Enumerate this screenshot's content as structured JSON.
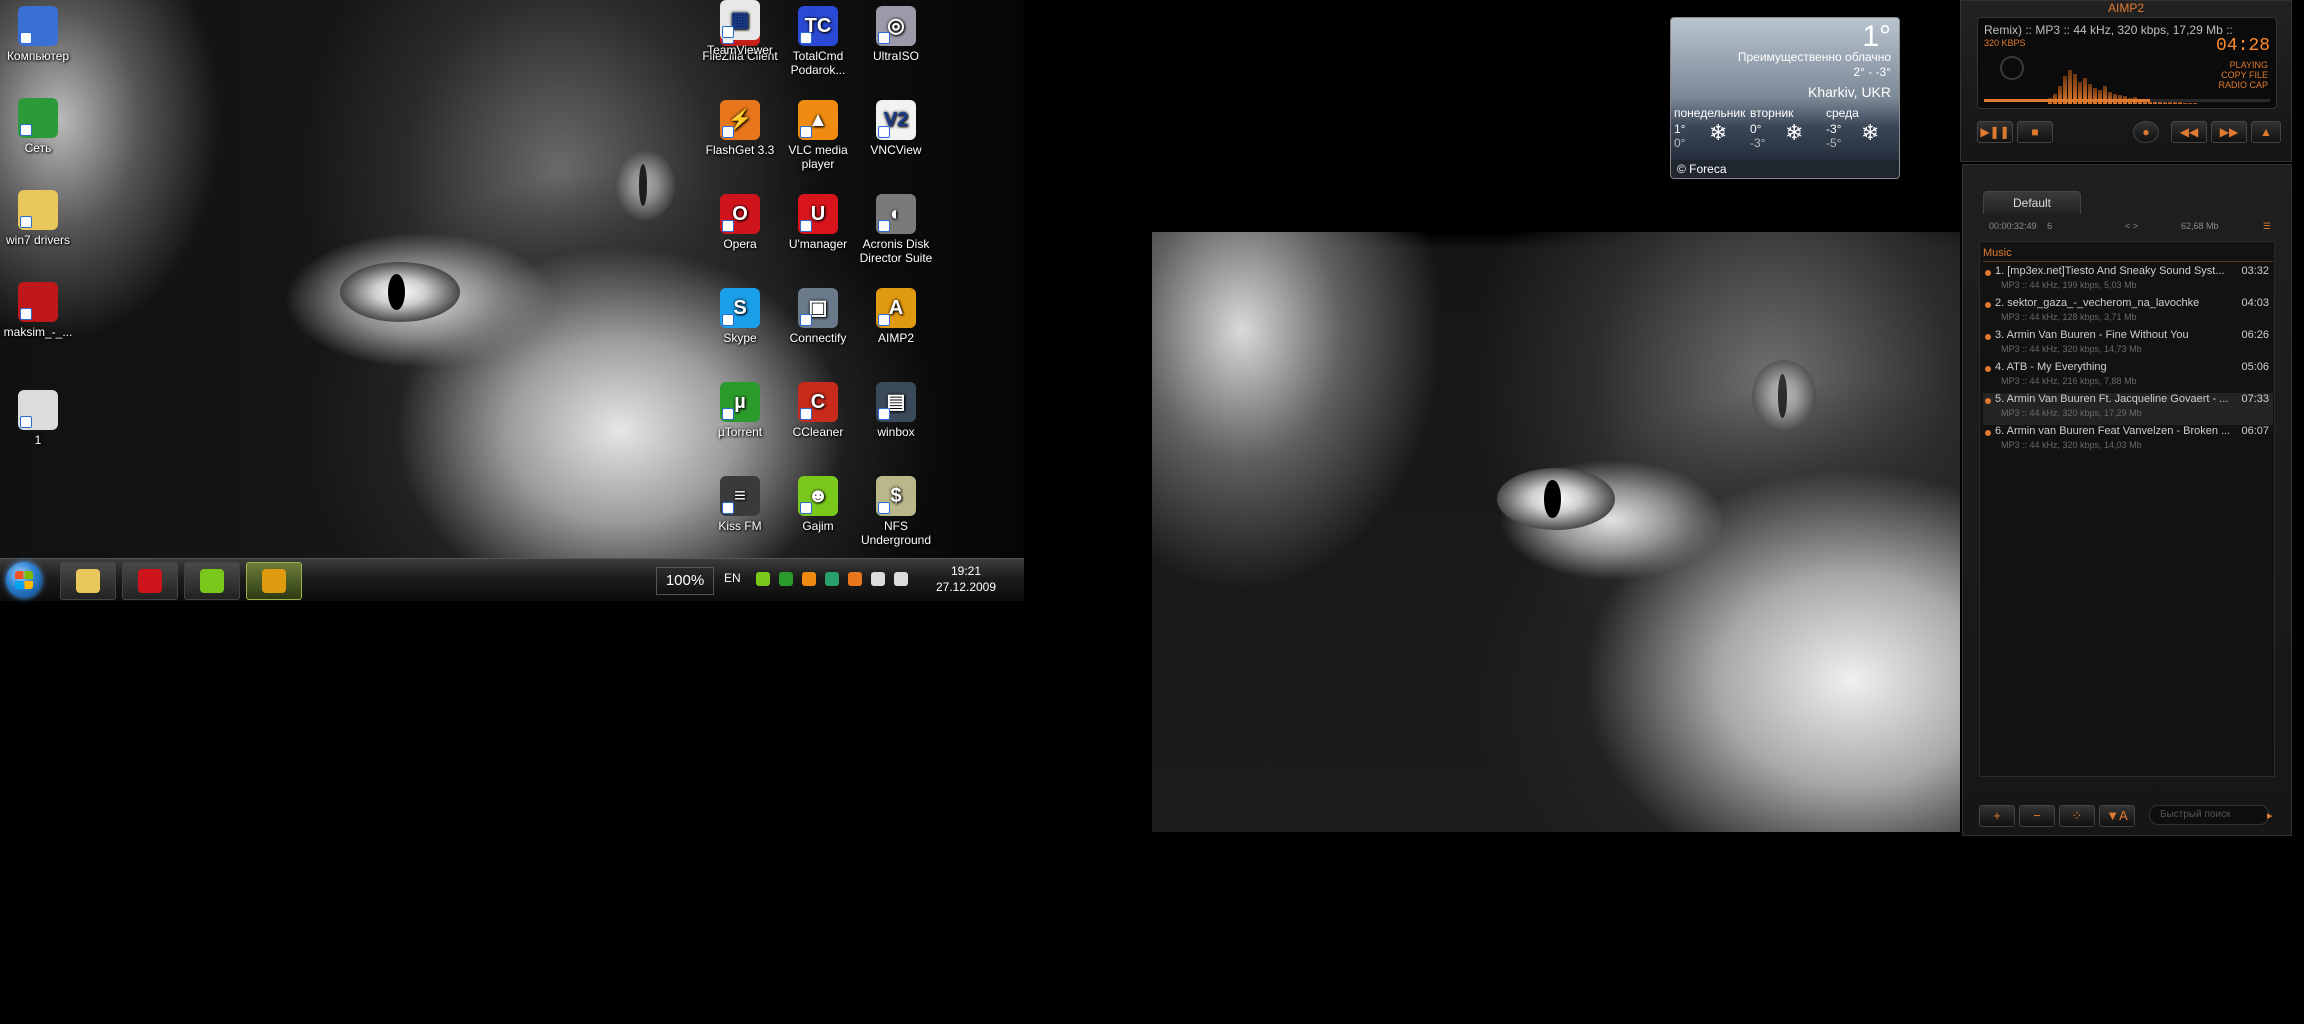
{
  "desktop_left": [
    {
      "label": "Компьютер",
      "icon": "computer-icon",
      "color": "#3a6fd6"
    },
    {
      "label": "Сеть",
      "icon": "network-globe-icon",
      "color": "#2a9a3a"
    },
    {
      "label": "win7 drivers",
      "icon": "folder-icon",
      "color": "#e8c85a"
    },
    {
      "label": "maksim_-_...",
      "icon": "audio-file-icon",
      "color": "#c01818"
    },
    {
      "label": "1",
      "icon": "keyboard-file-icon",
      "color": "#dcdcdc"
    }
  ],
  "desktop_grid": [
    {
      "label": "FileZilla Client",
      "icon": "filezilla-icon",
      "glyph": "FZ",
      "color": "#c8201c"
    },
    {
      "label": "TotalCmd Podarok...",
      "icon": "totalcmd-icon",
      "glyph": "TC",
      "color": "#2a4ad6"
    },
    {
      "label": "UltraISO",
      "icon": "disc-icon",
      "glyph": "◎",
      "color": "#9a9aa8"
    },
    {
      "label": "FlashGet 3.3",
      "icon": "flashget-icon",
      "glyph": "⚡",
      "color": "#e8761c"
    },
    {
      "label": "VLC media player",
      "icon": "vlc-cone-icon",
      "glyph": "▲",
      "color": "#f08a10"
    },
    {
      "label": "VNCView",
      "icon": "vnc-icon",
      "glyph": "V2",
      "color": "#f2f2f2"
    },
    {
      "label": "Opera",
      "icon": "opera-icon",
      "glyph": "O",
      "color": "#d0141c"
    },
    {
      "label": "U'manager",
      "icon": "utel-icon",
      "glyph": "U",
      "color": "#d8141c"
    },
    {
      "label": "Acronis Disk Director Suite",
      "icon": "acronis-icon",
      "glyph": "◐",
      "color": "#7a7a7a"
    },
    {
      "label": "Skype",
      "icon": "skype-icon",
      "glyph": "S",
      "color": "#1aa0e8"
    },
    {
      "label": "Connectify",
      "icon": "connectify-icon",
      "glyph": "▣",
      "color": "#6a7a8a"
    },
    {
      "label": "AIMP2",
      "icon": "aimp-icon",
      "glyph": "A",
      "color": "#e09a10"
    },
    {
      "label": "µTorrent",
      "icon": "utorrent-icon",
      "glyph": "µ",
      "color": "#2a9a2a"
    },
    {
      "label": "CCleaner",
      "icon": "ccleaner-icon",
      "glyph": "C",
      "color": "#c82a1c"
    },
    {
      "label": "winbox",
      "icon": "winbox-icon",
      "glyph": "▤",
      "color": "#3a4a5a"
    },
    {
      "label": "Kiss FM",
      "icon": "kissfm-icon",
      "glyph": "≡",
      "color": "#3a3a3a"
    },
    {
      "label": "Gajim",
      "icon": "gajim-icon",
      "glyph": "☻",
      "color": "#7ac81c"
    },
    {
      "label": "NFS Underground",
      "icon": "nfs-icon",
      "glyph": "$",
      "color": "#b8b88a"
    },
    {
      "label": "TeamViewer",
      "icon": "teamviewer-icon",
      "glyph": "▦",
      "color": "#e8e8e8"
    }
  ],
  "taskbar": {
    "buttons": [
      {
        "name": "explorer",
        "icon": "explorer-folder-icon",
        "color": "#e8c85a"
      },
      {
        "name": "opera",
        "icon": "opera-icon",
        "color": "#d0141c"
      },
      {
        "name": "gajim",
        "icon": "gajim-icon",
        "color": "#7ac81c"
      },
      {
        "name": "aimp",
        "icon": "aimp-icon",
        "color": "#e09a10"
      }
    ],
    "zoom": "100%",
    "lang": "EN",
    "time": "19:21",
    "date": "27.12.2009",
    "tray_colors": [
      "#7ac81c",
      "#2a9a2a",
      "#f08a10",
      "#2aa06a",
      "#e8761c",
      "#dcdcdc",
      "#dcdcdc"
    ]
  },
  "weather": {
    "temp": "1°",
    "condition": "Преимущественно облачно",
    "range": "2° - -3°",
    "city": "Kharkiv, UKR",
    "forecast": [
      {
        "day": "понедельник",
        "hi": "1°",
        "lo": "0°"
      },
      {
        "day": "вторник",
        "hi": "0°",
        "lo": "-3°"
      },
      {
        "day": "среда",
        "hi": "-3°",
        "lo": "-5°"
      }
    ],
    "source": "© Foreca"
  },
  "aimp": {
    "title": "AIMP2",
    "scroll": "Remix) :: MP3 :: 44 kHz, 320 kbps, 17,29 Mb ::",
    "bitrate": "320 KBPS",
    "time": "04:28",
    "state": [
      "PLAYING",
      "COPY FILE",
      "RADIO CAP"
    ],
    "accent": "#e07a2e"
  },
  "playlist": {
    "tab": "Default",
    "duration": "00:00:32:49",
    "count": "6",
    "size": "62,68 Mb",
    "group": "Music",
    "tracks": [
      {
        "title": "1. [mp3ex.net]Tiesto And Sneaky Sound Syst...",
        "duration": "03:32",
        "meta": "MP3 :: 44 kHz, 199 kbps, 5,03 Mb"
      },
      {
        "title": "2. sektor_gaza_-_vecherom_na_lavochke",
        "duration": "04:03",
        "meta": "MP3 :: 44 kHz, 128 kbps, 3,71 Mb"
      },
      {
        "title": "3. Armin Van Buuren - Fine Without You",
        "duration": "06:26",
        "meta": "MP3 :: 44 kHz, 320 kbps, 14,73 Mb"
      },
      {
        "title": "4. ATB - My Everything",
        "duration": "05:06",
        "meta": "MP3 :: 44 kHz, 216 kbps, 7,88 Mb"
      },
      {
        "title": "5. Armin Van Buuren Ft. Jacqueline Govaert - ...",
        "duration": "07:33",
        "meta": "MP3 :: 44 kHz, 320 kbps, 17,29 Mb"
      },
      {
        "title": "6. Armin van Buuren Feat Vanvelzen - Broken ...",
        "duration": "06:07",
        "meta": "MP3 :: 44 kHz, 320 kbps, 14,03 Mb"
      }
    ],
    "selected": 4,
    "search_placeholder": "Быстрый поиск"
  }
}
